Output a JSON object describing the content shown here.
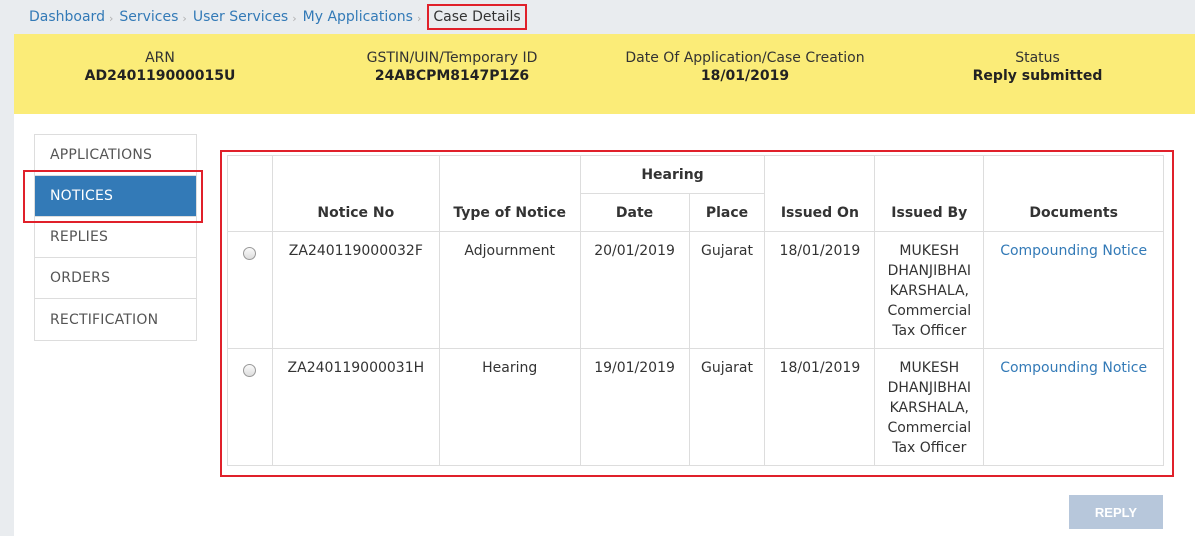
{
  "breadcrumb": {
    "items": [
      "Dashboard",
      "Services",
      "User Services",
      "My Applications"
    ],
    "current": "Case Details",
    "separator": "›"
  },
  "summary": {
    "arn_label": "ARN",
    "arn_value": "AD240119000015U",
    "gstin_label": "GSTIN/UIN/Temporary ID",
    "gstin_value": "24ABCPM8147P1Z6",
    "date_label": "Date Of Application/Case Creation",
    "date_value": "18/01/2019",
    "status_label": "Status",
    "status_value": "Reply submitted"
  },
  "sidenav": {
    "items": [
      "APPLICATIONS",
      "NOTICES",
      "REPLIES",
      "ORDERS",
      "RECTIFICATION"
    ],
    "active": "NOTICES"
  },
  "table": {
    "headers": {
      "notice_no": "Notice No",
      "type": "Type of Notice",
      "hearing": "Hearing",
      "date": "Date",
      "place": "Place",
      "issued_on": "Issued On",
      "issued_by": "Issued By",
      "documents": "Documents"
    },
    "rows": [
      {
        "notice_no": "ZA240119000032F",
        "type": "Adjournment",
        "date": "20/01/2019",
        "place": "Gujarat",
        "issued_on": "18/01/2019",
        "issued_by": [
          "MUKESH",
          "DHANJIBHAI",
          "KARSHALA,",
          "Commercial",
          "Tax Officer"
        ],
        "document": "Compounding Notice"
      },
      {
        "notice_no": "ZA240119000031H",
        "type": "Hearing",
        "date": "19/01/2019",
        "place": "Gujarat",
        "issued_on": "18/01/2019",
        "issued_by": [
          "MUKESH",
          "DHANJIBHAI",
          "KARSHALA,",
          "Commercial",
          "Tax Officer"
        ],
        "document": "Compounding Notice"
      }
    ]
  },
  "actions": {
    "reply_label": "REPLY"
  },
  "colors": {
    "accent": "#337ab7",
    "highlight": "#e0202a",
    "summary_bg": "#fbec78",
    "disabled_button": "#b7c7db"
  }
}
